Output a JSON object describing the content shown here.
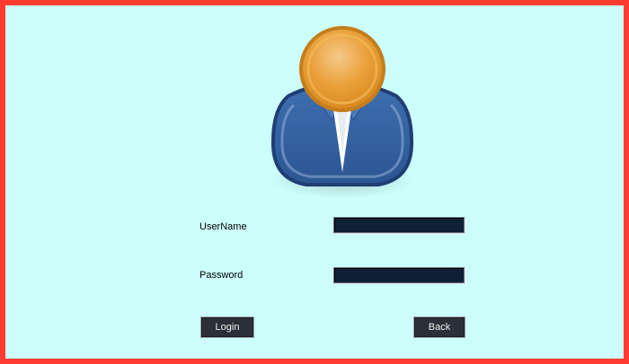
{
  "login_form": {
    "username_label": "UserName",
    "username_value": "",
    "password_label": "Password",
    "password_value": "",
    "login_button": "Login",
    "back_button": "Back"
  },
  "icons": {
    "avatar": "user-avatar-icon"
  },
  "colors": {
    "frame_border": "#ff3b30",
    "background": "#ccfffc",
    "input_background": "#0f1f35",
    "button_background": "#2b2f37"
  }
}
